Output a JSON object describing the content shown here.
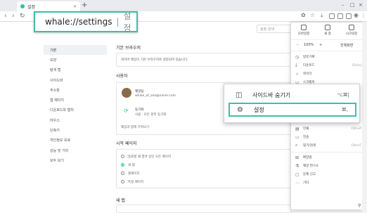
{
  "browser": {
    "tab_title": "설정",
    "tab_close": "×",
    "new_tab": "+",
    "window_controls": [
      "–",
      "□",
      "×"
    ],
    "nav": {
      "back": "‹",
      "forward": "›",
      "reload": "↻"
    }
  },
  "url_callout": {
    "url": "whale://settings",
    "label": "설정"
  },
  "settings": {
    "search_placeholder": "설정 검색",
    "sidebar": [
      "기본",
      "모양",
      "탐색 탭",
      "사이드바",
      "주소창",
      "웹 페이지",
      "다운로드와 캡처",
      "마우스",
      "단축키",
      "개인정보 보호",
      "성능 및 기타",
      "모두 보기"
    ],
    "default_browser": {
      "title": "기본 브라우저",
      "text": "네이버 웨일이 기본 브라우저로 설정되어 있습니다."
    },
    "user": {
      "title": "사용자",
      "name": "웨일팀",
      "email": "whale_of_sea@naver.com",
      "sync_label": "동기화",
      "sync_detail": "사용 · 모든 항목 동기화",
      "manage": "웨일과 함께 가져오기"
    },
    "startup": {
      "title": "시작 페이지",
      "options": [
        "종료할 때 열려 있던 모든 페이지",
        "새 탭",
        "홈페이지",
        "특정 페이지"
      ]
    },
    "new_tab_title": "새 탭"
  },
  "menu": {
    "top_items": [
      "모바일창",
      "새 창",
      "시크릿창"
    ],
    "zoom": {
      "minus": "–",
      "value": "100%",
      "plus": "+",
      "fullscreen": "전체화면"
    },
    "items": [
      {
        "label": "방문기록",
        "shortcut": ""
      },
      {
        "label": "다운로드",
        "shortcut": "Ctrl+J"
      },
      {
        "label": "북마크",
        "shortcut": ""
      },
      {
        "label": "스크랩북",
        "shortcut": ""
      },
      {
        "label": "인쇄",
        "shortcut": "Ctrl+P"
      },
      {
        "label": "전송",
        "shortcut": ""
      },
      {
        "label": "찾기/검색",
        "shortcut": "Ctrl+F"
      },
      {
        "label": "확장앱",
        "shortcut": ""
      },
      {
        "label": "웨일 연구소",
        "shortcut": ""
      },
      {
        "label": "문제 신고",
        "shortcut": ""
      },
      {
        "label": "기타",
        "shortcut": ""
      }
    ]
  },
  "menu_callout": {
    "items": [
      {
        "label": "사이드바 숨기기",
        "shortcut": "⌥⌘|",
        "icon": "sidebar-icon"
      },
      {
        "label": "설정",
        "shortcut": "⌘,",
        "icon": "gear-icon"
      }
    ]
  },
  "colors": {
    "accent": "#3fbfa4",
    "whale_green": "#1fc6a0"
  }
}
